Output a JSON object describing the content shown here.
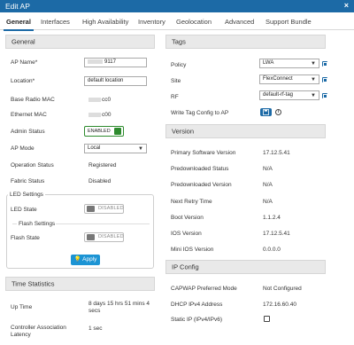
{
  "window": {
    "title": "Edit AP",
    "close": "×"
  },
  "tabs": [
    "General",
    "Interfaces",
    "High Availability",
    "Inventory",
    "Geolocation",
    "Advanced",
    "Support Bundle"
  ],
  "general": {
    "header": "General",
    "ap_name_label": "AP Name*",
    "ap_name_value": "9117",
    "location_label": "Location*",
    "location_value": "default location",
    "base_radio_mac_label": "Base Radio MAC",
    "base_radio_mac_value": "cc0",
    "ethernet_mac_label": "Ethernet MAC",
    "ethernet_mac_value": "c00",
    "admin_status_label": "Admin Status",
    "admin_status_value": "ENABLED",
    "ap_mode_label": "AP Mode",
    "ap_mode_value": "Local",
    "operation_status_label": "Operation Status",
    "operation_status_value": "Registered",
    "fabric_status_label": "Fabric Status",
    "fabric_status_value": "Disabled",
    "led_settings_title": "LED Settings",
    "led_state_label": "LED State",
    "led_state_value": "DISABLED",
    "flash_settings_title": "Flash Settings",
    "flash_state_label": "Flash State",
    "flash_state_value": "DISABLED",
    "apply_label": "Apply"
  },
  "time_statistics": {
    "header": "Time Statistics",
    "up_time_label": "Up Time",
    "up_time_value_1": "8 days 15 hrs 51 mins 4",
    "up_time_value_2": "secs",
    "controller_assoc_label_1": "Controller Association",
    "controller_assoc_label_2": "Latency",
    "controller_assoc_value": "1 sec"
  },
  "tags": {
    "header": "Tags",
    "policy_label": "Policy",
    "policy_value": "LWA",
    "site_label": "Site",
    "site_value": "FlexConnect",
    "rf_label": "RF",
    "rf_value": "default-rf-tag",
    "write_tag_label": "Write Tag Config to AP"
  },
  "version": {
    "header": "Version",
    "primary_label": "Primary Software Version",
    "primary_value": "17.12.5.41",
    "predownloaded_status_label": "Predownloaded Status",
    "predownloaded_status_value": "N/A",
    "predownloaded_version_label": "Predownloaded Version",
    "predownloaded_version_value": "N/A",
    "next_retry_label": "Next Retry Time",
    "next_retry_value": "N/A",
    "boot_label": "Boot Version",
    "boot_value": "1.1.2.4",
    "ios_label": "IOS Version",
    "ios_value": "17.12.5.41",
    "mini_ios_label": "Mini IOS Version",
    "mini_ios_value": "0.0.0.0"
  },
  "ip_config": {
    "header": "IP Config",
    "capwap_label": "CAPWAP Preferred Mode",
    "capwap_value": "Not Configured",
    "dhcp_label": "DHCP IPv4 Address",
    "dhcp_value": "172.16.60.40",
    "static_label": "Static IP (IPv4/IPv6)"
  },
  "colors": {
    "accent": "#1c6aa6",
    "enabled": "#2e8b2e",
    "apply": "#1c94d4"
  }
}
